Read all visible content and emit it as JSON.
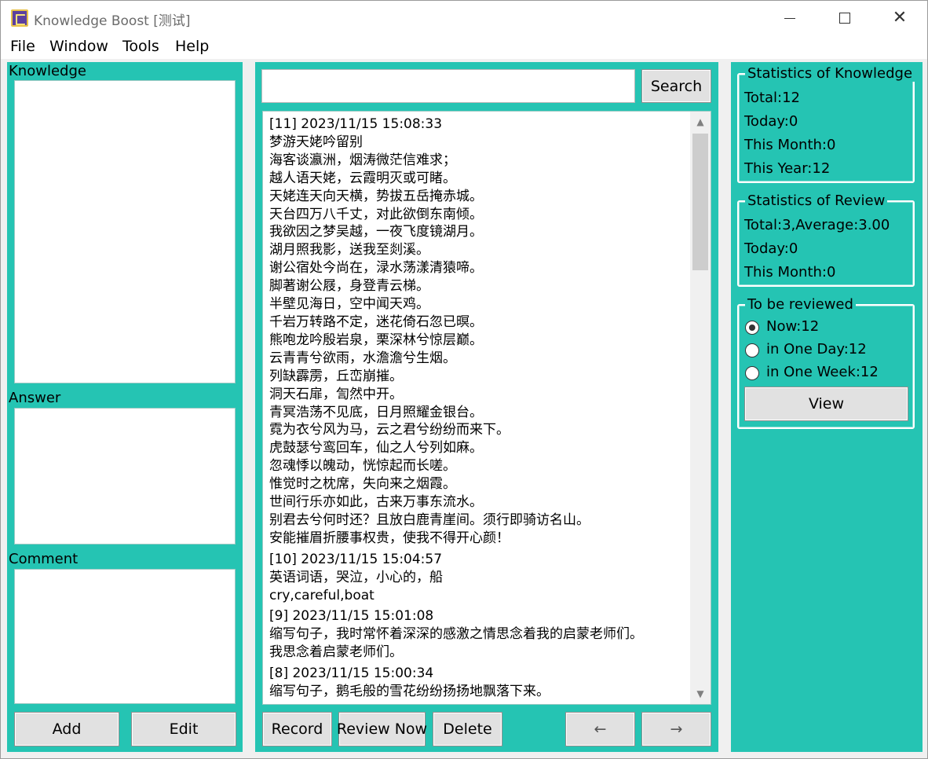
{
  "window": {
    "title": "Knowledge Boost [测试]",
    "controls": {
      "minimize": "minimize",
      "maximize": "maximize",
      "close": "✕"
    }
  },
  "menu": [
    "File",
    "Window",
    "Tools",
    "Help"
  ],
  "left": {
    "knowledge_label": "Knowledge",
    "answer_label": "Answer",
    "comment_label": "Comment",
    "add_label": "Add",
    "edit_label": "Edit"
  },
  "center": {
    "search_value": "",
    "search_label": "Search",
    "records": [
      {
        "header": "[11] 2023/11/15 15:08:33",
        "lines": [
          "梦游天姥吟留别",
          "海客谈瀛洲，烟涛微茫信难求；",
          "越人语天姥，云霞明灭或可睹。",
          "天姥连天向天横，势拔五岳掩赤城。",
          "天台四万八千丈，对此欲倒东南倾。",
          "我欲因之梦吴越，一夜飞度镜湖月。",
          "湖月照我影，送我至剡溪。",
          "谢公宿处今尚在，渌水荡漾清猿啼。",
          "脚著谢公屐，身登青云梯。",
          "半壁见海日，空中闻天鸡。",
          "千岩万转路不定，迷花倚石忽已暝。",
          "熊咆龙吟殷岩泉，栗深林兮惊层巅。",
          "云青青兮欲雨，水澹澹兮生烟。",
          "列缺霹雳，丘峦崩摧。",
          "洞天石扉，訇然中开。",
          "青冥浩荡不见底，日月照耀金银台。",
          "霓为衣兮风为马，云之君兮纷纷而来下。",
          "虎鼓瑟兮鸾回车，仙之人兮列如麻。",
          "忽魂悸以魄动，恍惊起而长嗟。",
          "惟觉时之枕席，失向来之烟霞。",
          "世间行乐亦如此，古来万事东流水。",
          "别君去兮何时还？且放白鹿青崖间。须行即骑访名山。",
          "安能摧眉折腰事权贵，使我不得开心颜！"
        ]
      },
      {
        "header": "[10] 2023/11/15 15:04:57",
        "lines": [
          "英语词语，哭泣，小心的，船",
          "cry,careful,boat"
        ]
      },
      {
        "header": "[9] 2023/11/15 15:01:08",
        "lines": [
          "缩写句子，我时常怀着深深的感激之情思念着我的启蒙老师们。",
          "我思念着启蒙老师们。"
        ]
      },
      {
        "header": "[8] 2023/11/15 15:00:34",
        "lines": [
          "缩写句子，鹅毛般的雪花纷纷扬扬地飘落下来。"
        ]
      }
    ],
    "record_label": "Record",
    "review_now_label": "Review Now",
    "delete_label": "Delete",
    "prev_label": "←",
    "next_label": "→"
  },
  "right": {
    "knowledge_stats": {
      "title": "Statistics of Knowledge",
      "total": "Total:12",
      "today": "Today:0",
      "month": "This Month:0",
      "year": "This Year:12"
    },
    "review_stats": {
      "title": "Statistics of Review",
      "total": "Total:3,Average:3.00",
      "today": "Today:0",
      "month": "This Month:0"
    },
    "to_review": {
      "title": "To be reviewed",
      "options": [
        "Now:12",
        "in One Day:12",
        "in One Week:12"
      ],
      "selected_index": 0,
      "view_label": "View"
    }
  },
  "colors": {
    "panel": "#25c4b3",
    "button": "#e1e1e1"
  }
}
